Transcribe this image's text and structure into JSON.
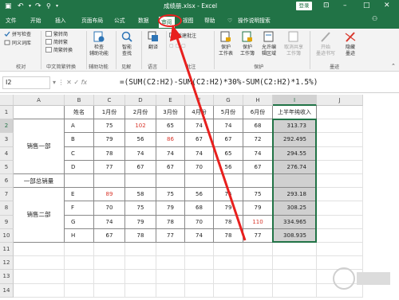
{
  "titlebar": {
    "title": "成绩册.xlsx - Excel",
    "login": "登录"
  },
  "tabs": [
    {
      "label": "文件"
    },
    {
      "label": "开始"
    },
    {
      "label": "插入"
    },
    {
      "label": "页面布局"
    },
    {
      "label": "公式"
    },
    {
      "label": "数据"
    },
    {
      "label": "审阅",
      "active": true
    },
    {
      "label": "视图"
    },
    {
      "label": "帮助"
    },
    {
      "label": "操作说明搜索"
    }
  ],
  "ribbon": {
    "spell_check": "拼写检查",
    "thesaurus": "同义词库",
    "group_proofing": "校对",
    "to_traditional": "繁转简",
    "to_simplified": "简转繁",
    "convert": "简繁转换",
    "group_chinese": "中文简繁转换",
    "check_accessibility": "检查\n辅助功能",
    "group_accessibility": "辅助功能",
    "smart_lookup": "智能\n查找",
    "group_insights": "见解",
    "translate": "翻译",
    "group_language": "语言",
    "new_comment": "新建批注",
    "group_comments": "批注",
    "protect_sheet": "保护\n工作表",
    "protect_workbook": "保护\n工作簿",
    "allow_edit_ranges": "允许编\n辑区域",
    "unshare_workbook": "取消共享\n工作簿",
    "group_protect": "保护",
    "start_ink": "开始\n墨迹书写",
    "hide_ink": "隐藏\n墨迹",
    "group_ink": "墨迹"
  },
  "formula_bar": {
    "name_box": "I2",
    "formula": "=(SUM(C2:H2)-SUM(C2:H2)*30%-SUM(C2:H2)*1.5%)"
  },
  "columns": [
    "A",
    "B",
    "C",
    "D",
    "E",
    "F",
    "G",
    "H",
    "I",
    "J"
  ],
  "rows": [
    "1",
    "2",
    "3",
    "4",
    "5",
    "6",
    "7",
    "8",
    "9",
    "10",
    "11",
    "12",
    "13",
    "14"
  ],
  "sheet": {
    "headers": [
      "姓名",
      "1月份",
      "2月份",
      "3月份",
      "4月份",
      "5月份",
      "6月份",
      "上半年纯收入"
    ],
    "group1": "销售一部",
    "summary": "一部总销量",
    "group2": "销售二部",
    "r2": [
      "A",
      "75",
      "102",
      "65",
      "74",
      "74",
      "68",
      "313.73"
    ],
    "r3": [
      "B",
      "79",
      "56",
      "86",
      "67",
      "67",
      "72",
      "292.495"
    ],
    "r4": [
      "C",
      "78",
      "74",
      "74",
      "74",
      "65",
      "74",
      "294.55"
    ],
    "r5": [
      "D",
      "77",
      "67",
      "67",
      "70",
      "56",
      "67",
      "276.74"
    ],
    "r7": [
      "E",
      "89",
      "58",
      "75",
      "56",
      "75",
      "75",
      "293.18"
    ],
    "r8": [
      "F",
      "70",
      "75",
      "79",
      "68",
      "79",
      "79",
      "308.25"
    ],
    "r9": [
      "G",
      "74",
      "79",
      "78",
      "70",
      "78",
      "110",
      "334.965"
    ],
    "r10": [
      "H",
      "67",
      "78",
      "77",
      "74",
      "78",
      "77",
      "308.935"
    ]
  },
  "colors": {
    "excel_green": "#217346",
    "annotation_red": "#e8201e",
    "highlight_red": "#d9362b"
  }
}
